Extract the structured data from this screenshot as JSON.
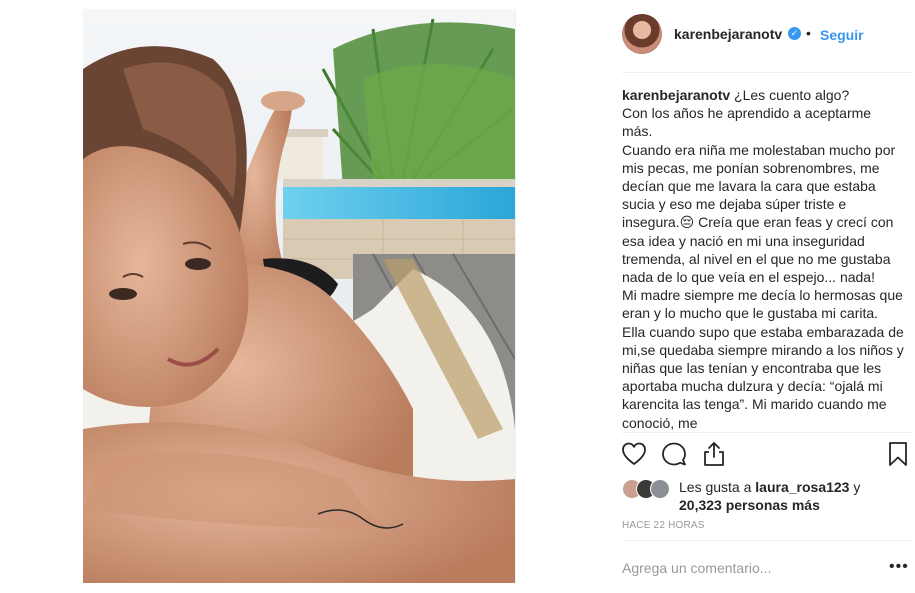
{
  "post": {
    "username": "karenbejaranotv",
    "verified_mark": "✓",
    "separator": "•",
    "follow_label": "Seguir",
    "caption_username": "karenbejaranotv",
    "caption_text": " ¿Les cuento algo?\nCon los años he aprendido a aceptarme más.\nCuando era niña me molestaban mucho por mis pecas, me ponían sobrenombres, me decían que me lavara la cara que estaba sucia y eso me dejaba súper triste e insegura.😔 Creía que eran feas y crecí con esa idea y nació en mi una inseguridad tremenda, al nivel en el que no me gustaba nada de lo que veía en el espejo... nada!\nMi madre siempre me decía lo hermosas que eran y lo mucho que le gustaba mi carita. Ella cuando supo que estaba embarazada de mi,se quedaba siempre mirando a los niños y niñas que las tenían y encontraba que les aportaba mucha dulzura y decía: “ojalá mi karencita las tenga”. Mi marido cuando me conoció, me",
    "icons": {
      "like": "heart-icon",
      "comment": "comment-icon",
      "share": "share-icon",
      "save": "bookmark-icon"
    },
    "likes_prefix": "Les gusta a ",
    "likes_user": "laura_rosa123",
    "likes_mid": " y",
    "likes_count": "20,323 personas más",
    "timestamp": "HACE 22 HORAS",
    "comment_placeholder": "Agrega un comentario...",
    "more_label": "•••",
    "colors": {
      "accent": "#3897f0",
      "text": "#262626",
      "muted": "#999999",
      "divider": "#efefef"
    }
  }
}
